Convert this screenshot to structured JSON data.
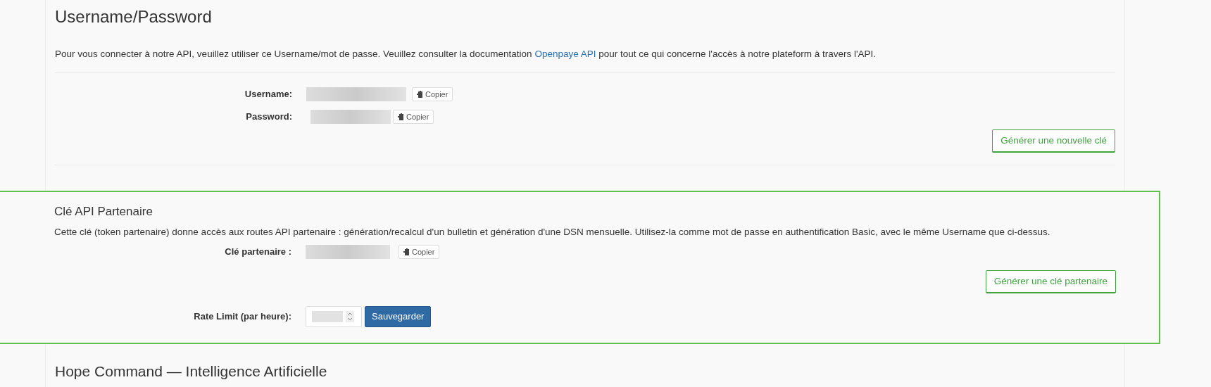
{
  "credentials": {
    "title": "Username/Password",
    "intro_before": "Pour vous connecter à notre API, veuillez utiliser ce Username/mot de passe. Veuillez consulter la documentation",
    "intro_link": "Openpaye API",
    "intro_after": "pour tout ce qui concerne l'accès à notre plateform à travers l'API.",
    "fields": [
      {
        "label": "Username:",
        "copy": "Copier"
      },
      {
        "label": "Password:",
        "copy": "Copier"
      }
    ],
    "generate_button": "Générer une nouvelle clé"
  },
  "partner": {
    "title": "Clé API Partenaire",
    "description": "Cette clé (token partenaire) donne accès aux routes API partenaire : génération/recalcul d'un bulletin et génération d'une DSN mensuelle. Utilisez-la comme mot de passe en authentification Basic, avec le même Username que ci-dessus.",
    "key_label": "Clé partenaire :",
    "copy": "Copier",
    "generate_button": "Générer une clé partenaire",
    "rate_label": "Rate Limit (par heure):",
    "save_button": "Sauvegarder"
  },
  "next_section": {
    "title": "Hope Command — Intelligence Artificielle"
  }
}
